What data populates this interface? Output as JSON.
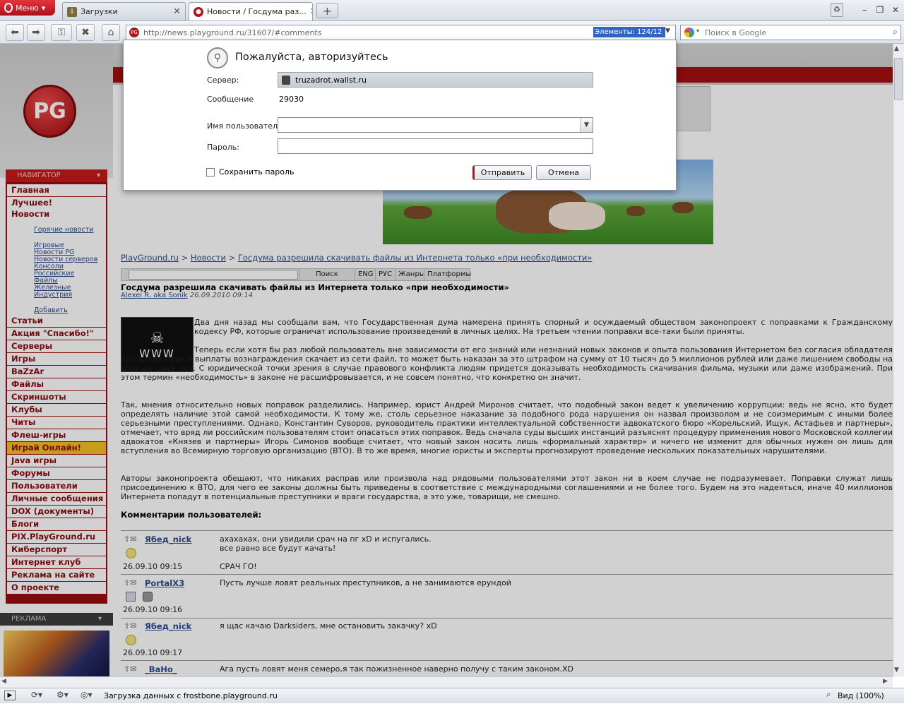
{
  "browser": {
    "menu_label": "Меню",
    "tabs": [
      {
        "label": "Загрузки"
      },
      {
        "label": "Новости / Госдума раз..."
      }
    ],
    "address": "http://news.playground.ru/31607/#comments",
    "elements_badge": "Элементы:   124/12",
    "search_placeholder": "Поиск в Google",
    "status_text": "Загрузка данных с frostbone.playground.ru",
    "zoom_label": "Вид (100%)"
  },
  "dialog": {
    "title": "Пожалуйста, авторизуйтесь",
    "server_label": "Сервер:",
    "server_value": "truzadrot.wallst.ru",
    "message_label": "Сообщение",
    "message_value": "29030",
    "username_label": "Имя пользователя:",
    "username_value": "",
    "password_label": "Пароль:",
    "password_value": "",
    "save_password_label": "Сохранить пароль",
    "ok_label": "Отправить",
    "cancel_label": "Отмена"
  },
  "site": {
    "logo": "PG",
    "navigator_label": "НАВИГАТОР",
    "nav_top": [
      "Главная",
      "Лучшее!",
      "Новости"
    ],
    "news_sub": [
      "Горячие новости",
      "Игровые",
      "Новости PG",
      "Новости серверов",
      "Консоли",
      "Российские",
      "Файлы",
      "Железные",
      "Индустрия",
      "Добавить"
    ],
    "nav_items": [
      "Статьи",
      "Акция \"Спасибо!\"",
      "Серверы",
      "Игры",
      "BaZzAr",
      "Файлы",
      "Скриншоты",
      "Клубы",
      "Читы",
      "Флеш-игры",
      "Играй Онлайн!",
      "Java игры",
      "Форумы",
      "Пользователи",
      "Личные сообщения",
      "DOX (документы)",
      "Блоги",
      "PIX.PlayGround.ru",
      "Киберспорт",
      "Интернет клуб",
      "Реклама на сайте",
      "О проекте"
    ],
    "ad_label": "РЕКЛАМА",
    "breadcrumb": {
      "root": "PlayGround.ru",
      "sep": ">",
      "section": "Новости",
      "current": "Госдума разрешила скачивать файлы из Интернета только «при необходимости»"
    },
    "search_buttons": [
      "Поиск",
      "ENG",
      "РУС",
      "Жанры",
      "Платформы"
    ],
    "skull_caption": "WWW"
  },
  "article": {
    "title": "Госдума разрешила скачивать файлы из Интернета только «при необходимости»",
    "author": "Alexei R. aka Sonik",
    "date": "26.09.2010 09:14",
    "p1": "Два дня назад мы сообщали вам, что Государственная дума намерена принять спорный и осуждаемый обществом законопроект с поправками к Гражданскому кодексу РФ, которые ограничат использование произведений в личных целях. На третьем чтении поправки все-таки были приняты.",
    "p2": "Теперь если хотя бы раз любой пользователь вне зависимости от его знаний или незнаний новых законов и опыта пользования Интернетом без согласия обладателя авторских прав и выплаты вознаграждения скачает из сети файл, то может быть наказан за это штрафом на сумму от 10 тысяч до 5 миллионов рублей или даже лишением свободы на срок до двух лет. С юридической точки зрения в случае правового конфликта людям придется доказывать необходимость скачивания фильма, музыки или даже изображений. При этом термин «необходимость» в законе не расшифровывается, и не совсем понятно, что конкретно он значит.",
    "p3": "Так, мнения относительно новых поправок разделились. Например, юрист Андрей Миронов считает, что подобный закон ведет к увеличению коррупции: ведь не ясно, кто будет определять наличие этой самой необходимости. К тому же, столь серьезное наказание за подобного рода нарушения он назвал произволом и не соизмеримым с иными более серьезными преступлениями. Однако, Константин Суворов, руководитель практики интеллектуальной собственности адвокатского бюро «Корельский, Ищук, Астафьев и партнеры», отмечает, что вряд ли российским пользователям стоит опасаться этих поправок. Ведь сначала суды высших инстанций разъяснят процедуру применения нового Московской коллегии адвокатов «Князев и партнеры» Игорь Симонов вообще считает, что новый закон носить лишь «формальный характер» и ничего не изменит для обычных нужен он лишь для вступления во Всемирную торговую организацию (ВТО). В то же время, многие юристы и эксперты прогнозируют проведение нескольких показательных нарушителями.",
    "p4": "Авторы законопроекта обещают, что никаких расправ или произвола над рядовыми пользователями этот закон ни в коем случае не подразумевает. Поправки служат лишь присоединению к ВТО, для чего ее законы должны быть приведены в соответствие с международными соглашениями и не более того. Будем на это надеяться, иначе 40 миллионов Интернета попадут в потенциальные преступники и враги государства, а это уже, товарищи, не смешно."
  },
  "comments": {
    "header": "Комментарии пользователей:",
    "items": [
      {
        "user": "Ябед_nick",
        "date": "26.09.10 09:15",
        "lines": [
          "ахахахах, они увидили срач на пг xD и испугались.",
          "все равно все будут качать!",
          "СРАЧ ГО!"
        ]
      },
      {
        "user": "PortalX3",
        "date": "26.09.10 09:16",
        "lines": [
          "Пусть лучше ловят реальных преступников, а не занимаются ерундой"
        ]
      },
      {
        "user": "Ябед_nick",
        "date": "26.09.10 09:17",
        "lines": [
          "я щас качаю Darksiders, мне остановить закачку? xD"
        ]
      },
      {
        "user": "_BaHo_",
        "date": "",
        "lines": [
          "Ага пусть ловят меня семеро,я так пожизненное наверно получу с таким законом.XD"
        ]
      }
    ]
  }
}
